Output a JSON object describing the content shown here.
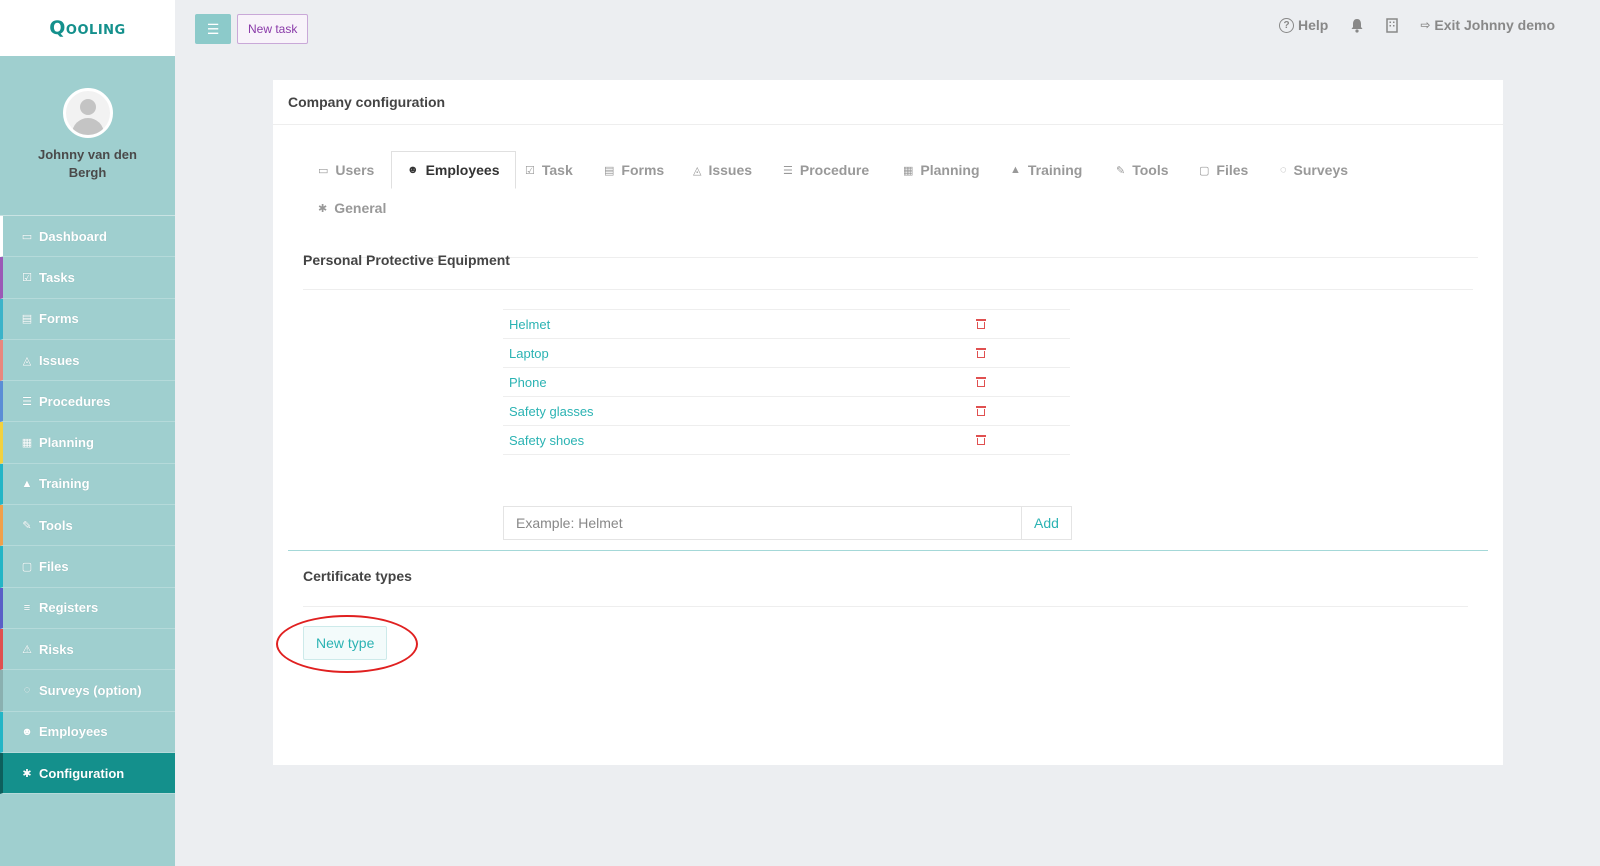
{
  "app": {
    "logo": "Qooling",
    "user_name": "Johnny van den Bergh"
  },
  "sidebar": {
    "items": [
      {
        "label": "Dashboard",
        "icon": "▭",
        "color": "#ffffff"
      },
      {
        "label": "Tasks",
        "icon": "☑",
        "color": "#9b59b6"
      },
      {
        "label": "Forms",
        "icon": "▤",
        "color": "#3bb3c9"
      },
      {
        "label": "Issues",
        "icon": "◬",
        "color": "#e8877e"
      },
      {
        "label": "Procedures",
        "icon": "☰",
        "color": "#5b8dd6"
      },
      {
        "label": "Planning",
        "icon": "▦",
        "color": "#f1d13f"
      },
      {
        "label": "Training",
        "icon": "▲",
        "color": "#23b5c6"
      },
      {
        "label": "Tools",
        "icon": "✎",
        "color": "#f0a04b"
      },
      {
        "label": "Files",
        "icon": "▢",
        "color": "#23b5c6"
      },
      {
        "label": "Registers",
        "icon": "≡",
        "color": "#5a5fc7"
      },
      {
        "label": "Risks",
        "icon": "⚠",
        "color": "#e05050"
      },
      {
        "label": "Surveys (option)",
        "icon": "◌",
        "color": "#8ab0b0"
      },
      {
        "label": "Employees",
        "icon": "☻",
        "color": "#23b5c6"
      },
      {
        "label": "Configuration",
        "icon": "✱",
        "color": "#0d5f5c",
        "active": true
      }
    ]
  },
  "topbar": {
    "new_task_label": "New task",
    "help_label": "Help",
    "exit_label": "Exit Johnny demo"
  },
  "card": {
    "title": "Company configuration"
  },
  "tabs": [
    {
      "label": "Users",
      "icon": "▭"
    },
    {
      "label": "Employees",
      "icon": "☻",
      "active": true
    },
    {
      "label": "Task",
      "icon": "☑"
    },
    {
      "label": "Forms",
      "icon": "▤"
    },
    {
      "label": "Issues",
      "icon": "◬"
    },
    {
      "label": "Procedure",
      "icon": "☰"
    },
    {
      "label": "Planning",
      "icon": "▦"
    },
    {
      "label": "Training",
      "icon": "▲"
    },
    {
      "label": "Tools",
      "icon": "✎"
    },
    {
      "label": "Files",
      "icon": "▢"
    },
    {
      "label": "Surveys",
      "icon": "◌"
    },
    {
      "label": "General",
      "icon": "✱"
    }
  ],
  "ppe": {
    "title": "Personal Protective Equipment",
    "items": [
      "Helmet",
      "Laptop",
      "Phone",
      "Safety glasses",
      "Safety shoes"
    ],
    "input_placeholder": "Example: Helmet",
    "add_label": "Add"
  },
  "certificates": {
    "title": "Certificate types",
    "new_type_label": "New type"
  }
}
